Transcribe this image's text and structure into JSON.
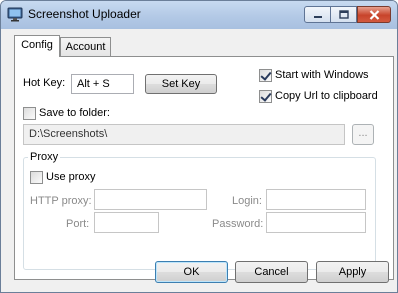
{
  "window": {
    "title": "Screenshot Uploader",
    "icons": {
      "app": "monitor-icon",
      "minimize": "minimize-icon",
      "maximize": "maximize-icon",
      "close": "close-icon"
    }
  },
  "tabs": [
    {
      "label": "Config",
      "selected": true
    },
    {
      "label": "Account",
      "selected": false
    }
  ],
  "config": {
    "hotkey_label": "Hot Key:",
    "hotkey_value": "Alt + S",
    "set_key_label": "Set Key",
    "start_with_windows": {
      "label": "Start with Windows",
      "checked": true
    },
    "copy_url": {
      "label": "Copy Url to clipboard",
      "checked": true
    },
    "save_to_folder": {
      "label": "Save to folder:",
      "checked": false
    },
    "folder_path": "D:\\Screenshots\\",
    "browse_label": "...",
    "proxy": {
      "group_label": "Proxy",
      "use_proxy": {
        "label": "Use proxy",
        "checked": false
      },
      "http_proxy_label": "HTTP proxy:",
      "port_label": "Port:",
      "login_label": "Login:",
      "password_label": "Password:",
      "http_proxy_value": "",
      "port_value": "",
      "login_value": "",
      "password_value": ""
    }
  },
  "buttons": {
    "ok": "OK",
    "cancel": "Cancel",
    "apply": "Apply"
  }
}
